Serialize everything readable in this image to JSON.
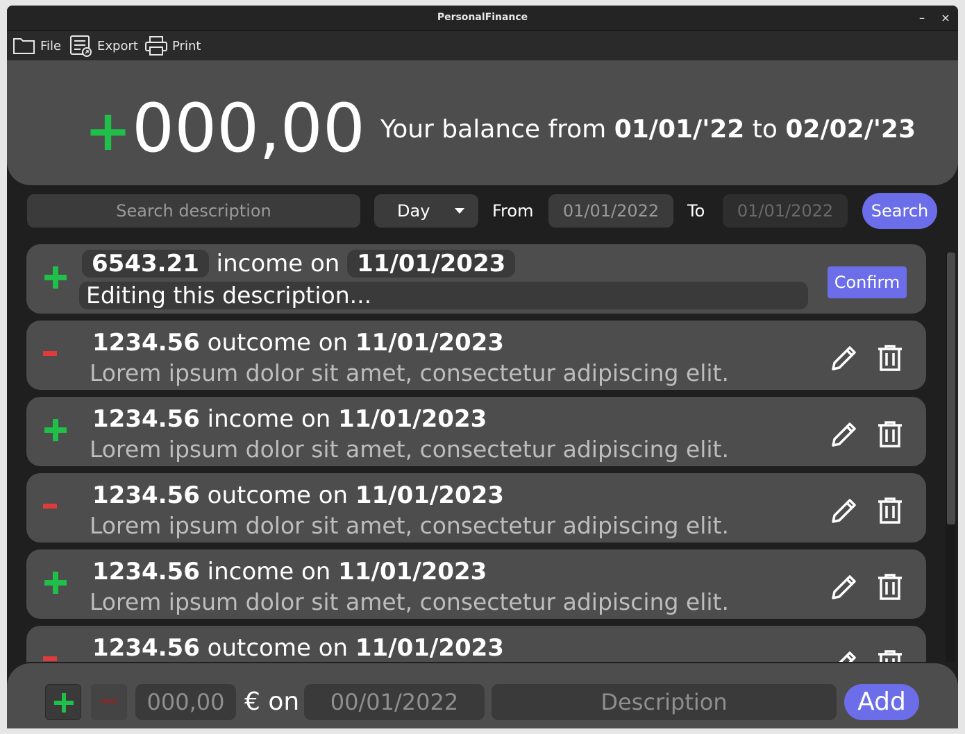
{
  "window": {
    "title": "PersonalFinance",
    "minimize": "–",
    "close": "×"
  },
  "menu": {
    "file": "File",
    "export": "Export",
    "print": "Print"
  },
  "balance": {
    "sign": "+",
    "amount": "000,00",
    "text_prefix": "Your balance from",
    "from_date": "01/01/'22",
    "text_to": "to",
    "to_date": "02/02/'23"
  },
  "filters": {
    "search_placeholder": "Search description",
    "period": "Day",
    "from_label": "From",
    "from_value": "01/01/2022",
    "to_label": "To",
    "to_value": "01/01/2022",
    "search_button": "Search"
  },
  "editing": {
    "amount": "6543.21",
    "type": "income on",
    "date": "11/01/2023",
    "description": "Editing this description...",
    "confirm": "Confirm"
  },
  "transactions": [
    {
      "sign": "minus",
      "amount": "1234.56",
      "type": "outcome on",
      "date": "11/01/2023",
      "description": "Lorem ipsum dolor sit amet, consectetur adipiscing elit."
    },
    {
      "sign": "plus",
      "amount": "1234.56",
      "type": "income on",
      "date": "11/01/2023",
      "description": "Lorem ipsum dolor sit amet, consectetur adipiscing elit."
    },
    {
      "sign": "minus",
      "amount": "1234.56",
      "type": "outcome on",
      "date": "11/01/2023",
      "description": "Lorem ipsum dolor sit amet, consectetur adipiscing elit."
    },
    {
      "sign": "plus",
      "amount": "1234.56",
      "type": "income on",
      "date": "11/01/2023",
      "description": "Lorem ipsum dolor sit amet, consectetur adipiscing elit."
    },
    {
      "sign": "minus",
      "amount": "1234.56",
      "type": "outcome on",
      "date": "11/01/2023",
      "description": ""
    }
  ],
  "footer": {
    "amount_placeholder": "000,00",
    "currency_on": "€ on",
    "date_placeholder": "00/01/2022",
    "description_placeholder": "Description",
    "add_button": "Add"
  },
  "colors": {
    "income": "#1fbf4a",
    "outcome": "#e03a3a",
    "accent": "#6b6ee8"
  }
}
